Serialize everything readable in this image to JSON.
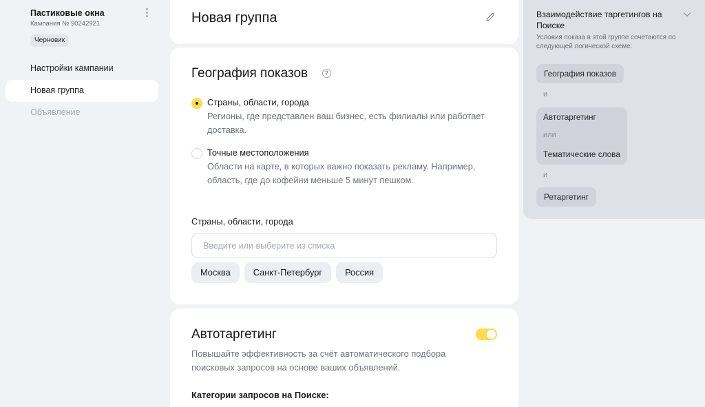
{
  "sidebar": {
    "campaign_title": "Пастиковые окна",
    "campaign_id": "Кампания № 90242921",
    "status_badge": "Черновик",
    "nav": [
      {
        "label": "Настройки кампании"
      },
      {
        "label": "Новая группа"
      },
      {
        "label": "Объявление"
      }
    ]
  },
  "group": {
    "title": "Новая группа"
  },
  "geo": {
    "title": "География показов",
    "help_glyph": "?",
    "options": [
      {
        "label": "Страны, области, города",
        "desc": "Регионы, где представлен ваш бизнес, есть филиалы или работает доставка.",
        "checked": true
      },
      {
        "label": "Точные местоположения",
        "desc": "Области на карте, в которых важно показать рекламу. Например, область, где до кофейни меньше 5 минут пешком.",
        "checked": false
      }
    ],
    "field_label": "Страны, области, города",
    "input_value": "",
    "input_placeholder": "Введите или выберите из списка",
    "chips": [
      "Москва",
      "Санкт-Петербург",
      "Россия"
    ]
  },
  "autotargeting": {
    "title": "Автотаргетинг",
    "enabled": true,
    "desc": "Повышайте эффективность за счёт автоматического подбора поисковых запросов на основе ваших объявлений.",
    "categories_label": "Категории запросов на Поиске:"
  },
  "interaction_panel": {
    "title": "Взаимодействие таргетингов на Поиске",
    "subtitle": "Условия показа в этой группе сочетаются по следующей логической схеме:",
    "geo_chip": "География показов",
    "op_and_1": "и",
    "group_item_1": "Автотаргетинг",
    "group_op_or": "или",
    "group_item_2": "Тематические слова",
    "op_and_2": "и",
    "retargeting_chip": "Ретаргетинг"
  },
  "colors": {
    "accent_yellow": "#ffdb4d",
    "page_bg": "#f1f2f5",
    "panel_bg": "#dfe1e8"
  },
  "icons": [
    "kebab-menu-icon",
    "pencil-icon",
    "help-icon",
    "chevron-down-icon"
  ]
}
